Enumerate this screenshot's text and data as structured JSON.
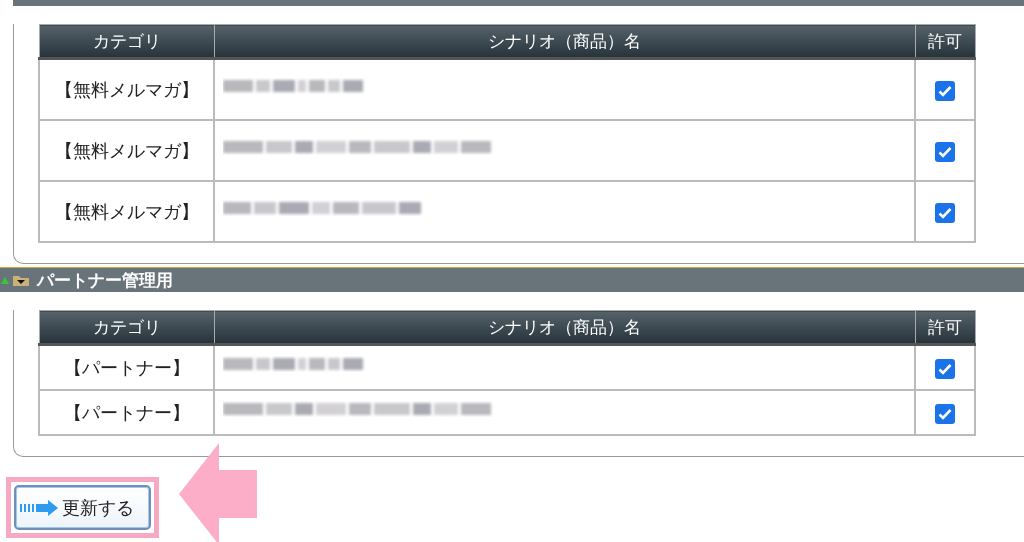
{
  "sections": [
    {
      "columns": [
        "カテゴリ",
        "シナリオ（商品）名",
        "許可"
      ],
      "rows": [
        {
          "category": "【無料メルマガ】",
          "allowed": true
        },
        {
          "category": "【無料メルマガ】",
          "allowed": true
        },
        {
          "category": "【無料メルマガ】",
          "allowed": true
        }
      ]
    },
    {
      "title": "パートナー管理用",
      "columns": [
        "カテゴリ",
        "シナリオ（商品）名",
        "許可"
      ],
      "rows": [
        {
          "category": "【パートナー】",
          "allowed": true
        },
        {
          "category": "【パートナー】",
          "allowed": true
        }
      ]
    }
  ],
  "update_button": {
    "label": "更新する"
  }
}
